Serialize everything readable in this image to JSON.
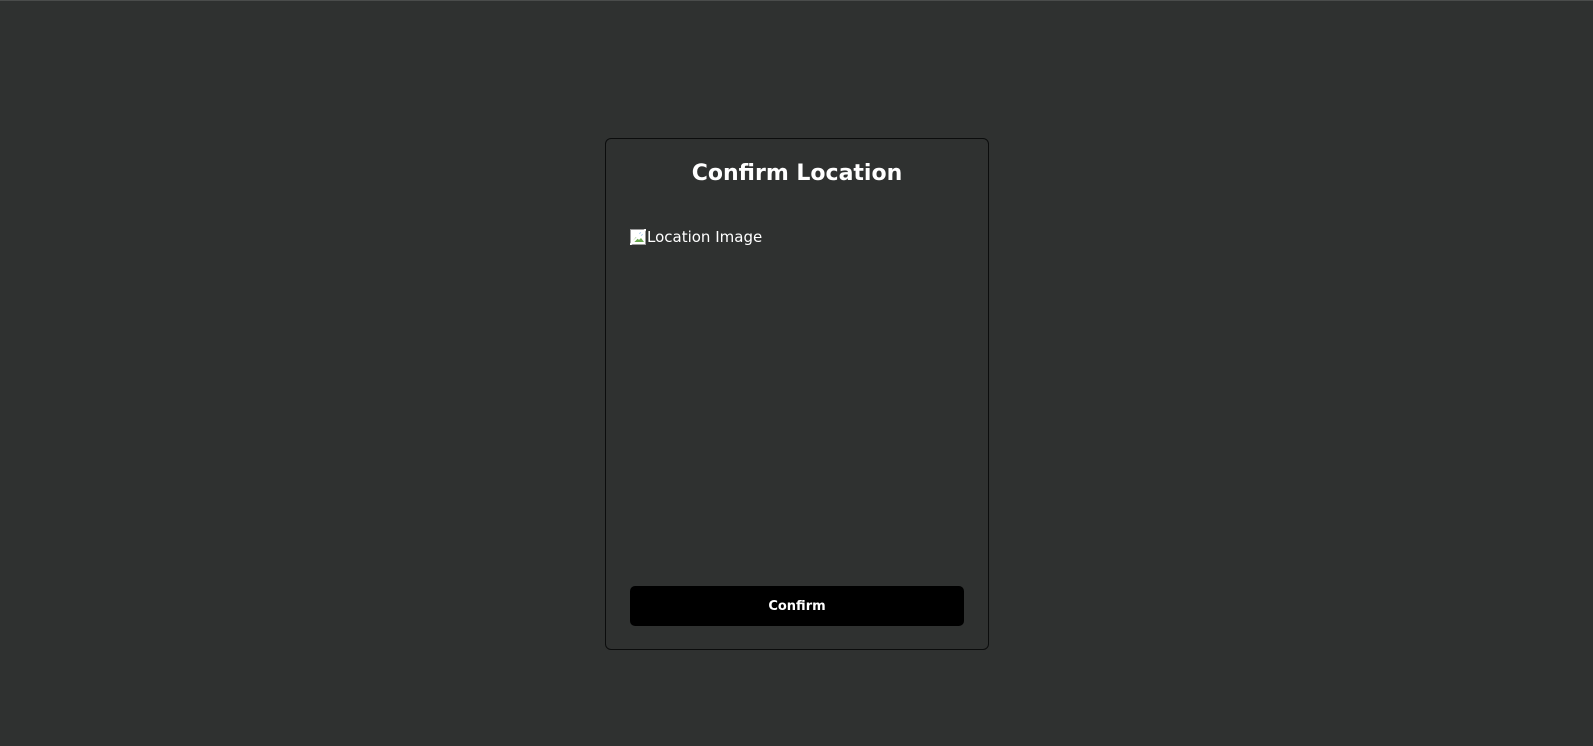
{
  "dialog": {
    "title": "Confirm Location",
    "image_alt": "Location Image",
    "confirm_label": "Confirm"
  },
  "icons": {
    "broken_image": "broken-image-icon"
  },
  "colors": {
    "background": "#2f3130",
    "card_border": "#0b0c0c",
    "button_bg": "#000000",
    "text": "#ffffff"
  }
}
